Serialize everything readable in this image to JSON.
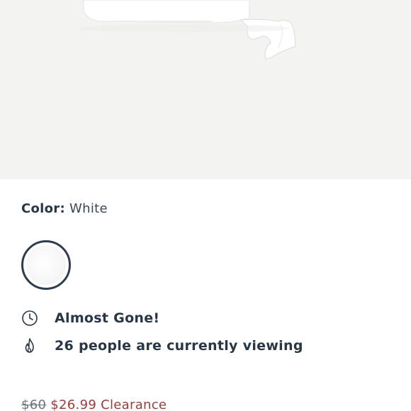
{
  "color": {
    "label": "Color:",
    "value": "White"
  },
  "swatches": [
    {
      "name": "White",
      "selected": true
    }
  ],
  "status": {
    "almost_gone": "Almost Gone!",
    "viewing": "26 people are currently viewing",
    "clock_icon": "clock-icon",
    "flame_icon": "flame-icon"
  },
  "price": {
    "original": "$60",
    "sale": "$26.99",
    "tag": "Clearance"
  },
  "colors": {
    "text_dark": "#283645",
    "sale_red": "#9b3b3b",
    "swatch_border": "#2f3d4c",
    "image_bg": "#f3f3f1"
  }
}
